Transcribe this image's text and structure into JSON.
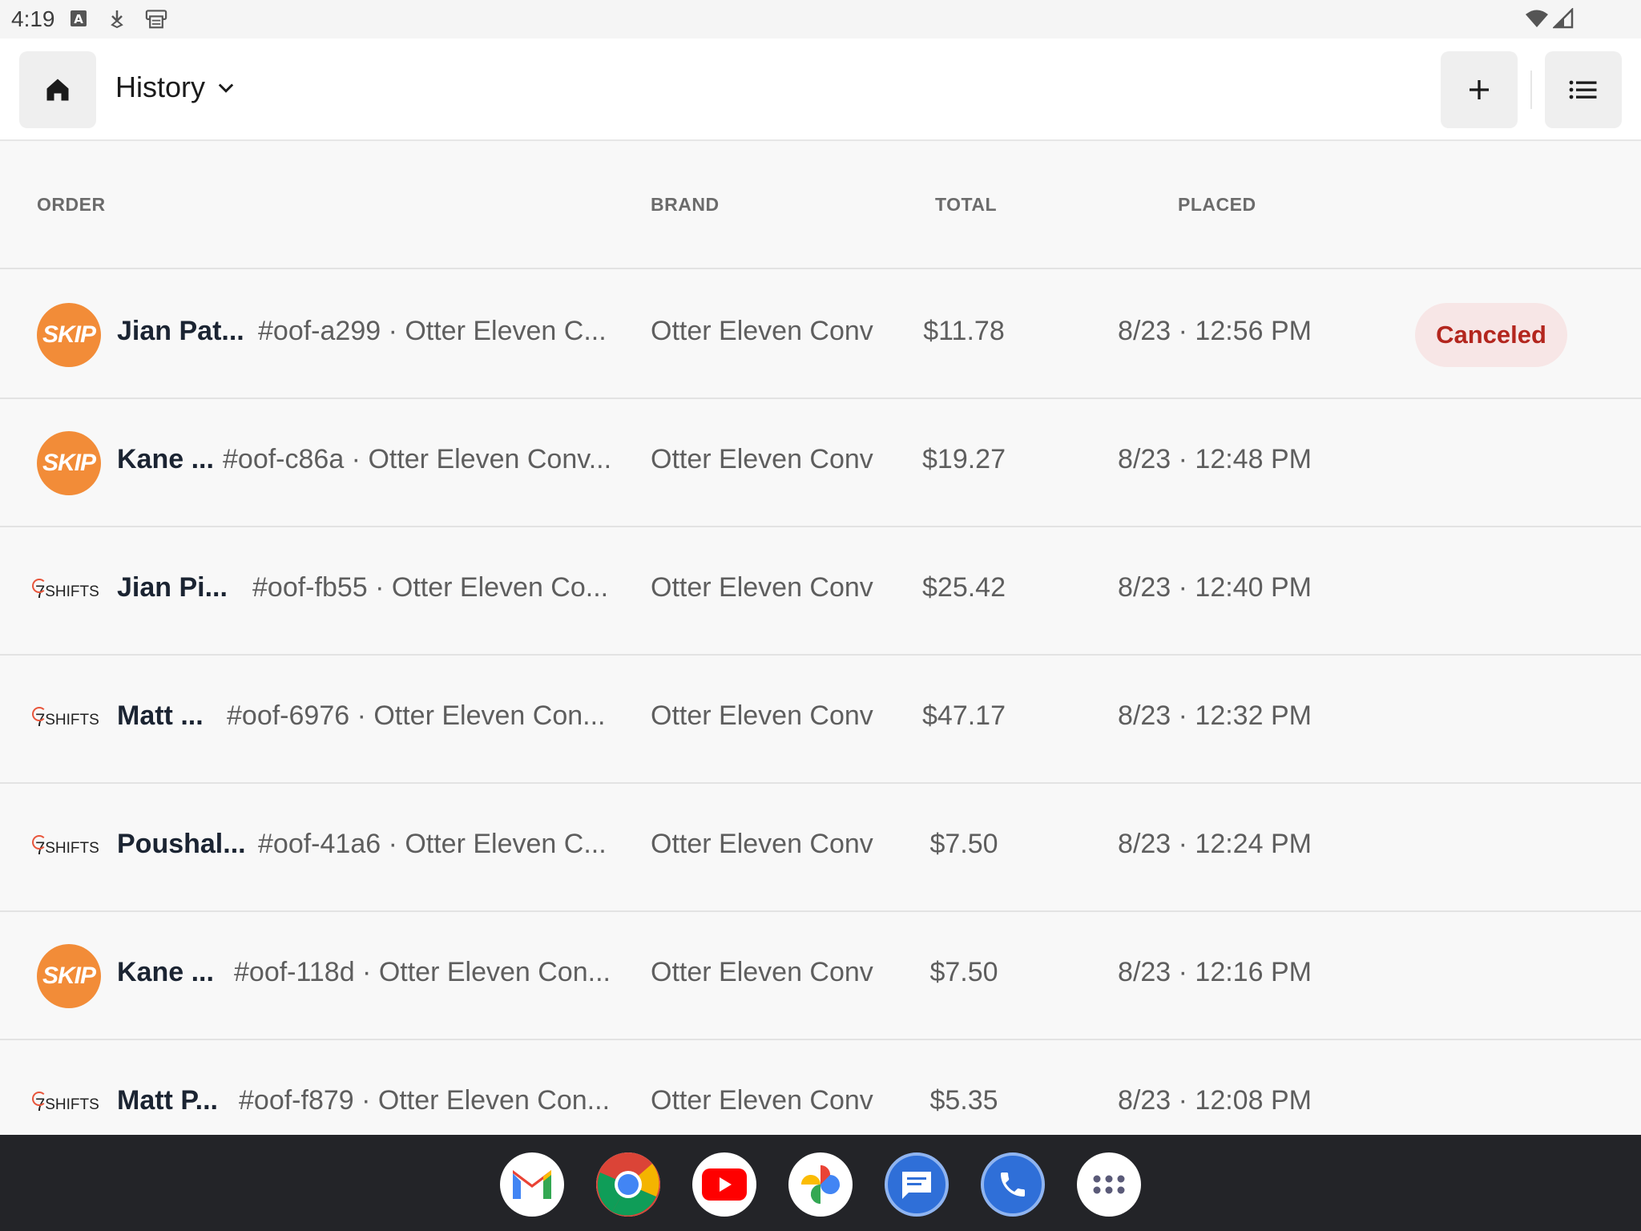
{
  "status_bar": {
    "time": "4:19"
  },
  "header": {
    "title": "History"
  },
  "columns": {
    "order": "ORDER",
    "brand": "BRAND",
    "total": "TOTAL",
    "placed": "PLACED"
  },
  "rows": [
    {
      "source": "skip",
      "customer": "Jian Pat...",
      "order": "#oof-a299 · Otter Eleven C...",
      "brand": "Otter Eleven Conv",
      "total": "$11.78",
      "placed": "8/23 · 12:56 PM",
      "status": "Canceled"
    },
    {
      "source": "skip",
      "customer": "Kane ...",
      "order": "#oof-c86a · Otter Eleven Conv...",
      "brand": "Otter Eleven Conv",
      "total": "$19.27",
      "placed": "8/23 · 12:48 PM",
      "status": ""
    },
    {
      "source": "7shifts",
      "customer": "Jian Pi...",
      "order": "#oof-fb55 · Otter Eleven Co...",
      "brand": "Otter Eleven Conv",
      "total": "$25.42",
      "placed": "8/23 · 12:40 PM",
      "status": ""
    },
    {
      "source": "7shifts",
      "customer": "Matt ...",
      "order": "#oof-6976 · Otter Eleven Con...",
      "brand": "Otter Eleven Conv",
      "total": "$47.17",
      "placed": "8/23 · 12:32 PM",
      "status": ""
    },
    {
      "source": "7shifts",
      "customer": "Poushal...",
      "order": "#oof-41a6 · Otter Eleven C...",
      "brand": "Otter Eleven Conv",
      "total": "$7.50",
      "placed": "8/23 · 12:24 PM",
      "status": ""
    },
    {
      "source": "skip",
      "customer": "Kane ...",
      "order": "#oof-118d · Otter Eleven Con...",
      "brand": "Otter Eleven Conv",
      "total": "$7.50",
      "placed": "8/23 · 12:16 PM",
      "status": ""
    },
    {
      "source": "7shifts",
      "customer": "Matt P...",
      "order": "#oof-f879 · Otter Eleven Con...",
      "brand": "Otter Eleven Conv",
      "total": "$5.35",
      "placed": "8/23 · 12:08 PM",
      "status": ""
    }
  ],
  "logos": {
    "skip": "SKIP",
    "sevenshifts_prefix": "7",
    "sevenshifts_suffix": "SHIFTS"
  },
  "dock": [
    "gmail-icon",
    "chrome-icon",
    "youtube-icon",
    "photos-icon",
    "messages-icon",
    "phone-icon",
    "app-drawer-icon"
  ],
  "colors": {
    "skip_orange": "#f28c38",
    "canceled_red": "#b3261e",
    "canceled_bg": "#f7e6e6"
  }
}
